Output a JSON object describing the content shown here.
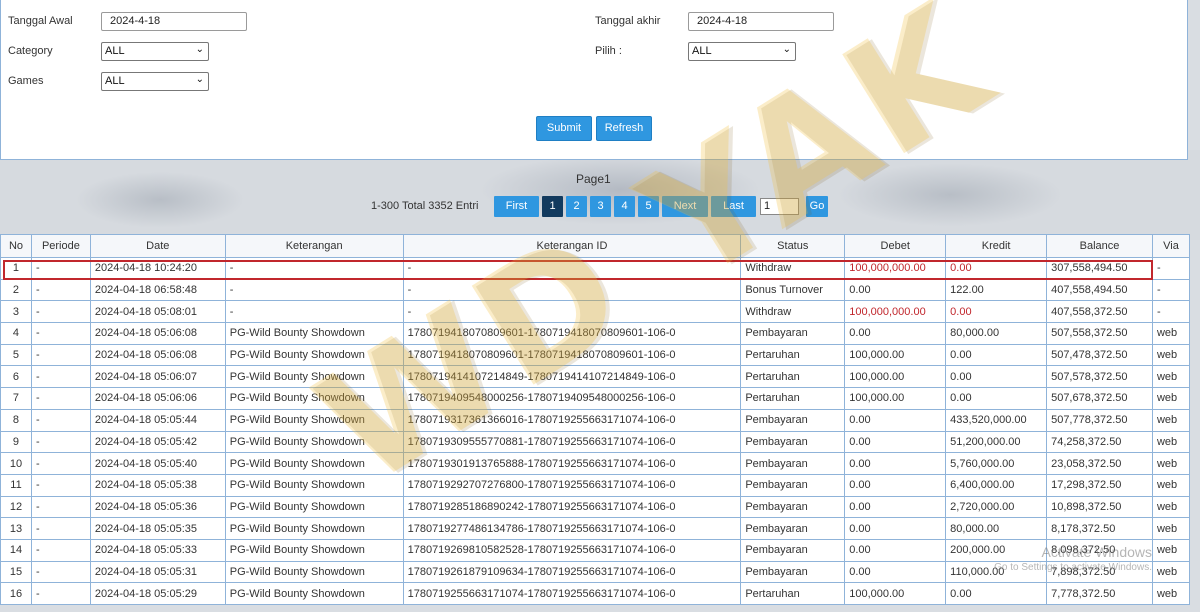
{
  "filters": {
    "tanggal_awal_label": "Tanggal Awal",
    "tanggal_awal_value": "2024-4-18",
    "tanggal_akhir_label": "Tanggal akhir",
    "tanggal_akhir_value": "2024-4-18",
    "category_label": "Category",
    "category_value": "ALL",
    "pilih_label": "Pilih :",
    "pilih_value": "ALL",
    "games_label": "Games",
    "games_value": "ALL",
    "submit_label": "Submit",
    "refresh_label": "Refresh"
  },
  "pager": {
    "title": "Page1",
    "range": "1-300 Total 3352 Entri",
    "first": "First",
    "pages": [
      "1",
      "2",
      "3",
      "4",
      "5"
    ],
    "next": "Next",
    "last": "Last",
    "page_input": "1",
    "go": "Go"
  },
  "table": {
    "headers": [
      "No",
      "Periode",
      "Date",
      "Keterangan",
      "Keterangan ID",
      "Status",
      "Debet",
      "Kredit",
      "Balance",
      "Via"
    ],
    "rows": [
      [
        "1",
        "-",
        "2024-04-18 10:24:20",
        "-",
        "-",
        "Withdraw",
        "100,000,000.00",
        "0.00",
        "307,558,494.50",
        "-"
      ],
      [
        "2",
        "-",
        "2024-04-18 06:58:48",
        "-",
        "-",
        "Bonus Turnover",
        "0.00",
        "122.00",
        "407,558,494.50",
        "-"
      ],
      [
        "3",
        "-",
        "2024-04-18 05:08:01",
        "-",
        "-",
        "Withdraw",
        "100,000,000.00",
        "0.00",
        "407,558,372.50",
        "-"
      ],
      [
        "4",
        "-",
        "2024-04-18 05:06:08",
        "PG-Wild Bounty Showdown",
        "1780719418070809601-1780719418070809601-106-0",
        "Pembayaran",
        "0.00",
        "80,000.00",
        "507,558,372.50",
        "web"
      ],
      [
        "5",
        "-",
        "2024-04-18 05:06:08",
        "PG-Wild Bounty Showdown",
        "1780719418070809601-1780719418070809601-106-0",
        "Pertaruhan",
        "100,000.00",
        "0.00",
        "507,478,372.50",
        "web"
      ],
      [
        "6",
        "-",
        "2024-04-18 05:06:07",
        "PG-Wild Bounty Showdown",
        "1780719414107214849-1780719414107214849-106-0",
        "Pertaruhan",
        "100,000.00",
        "0.00",
        "507,578,372.50",
        "web"
      ],
      [
        "7",
        "-",
        "2024-04-18 05:06:06",
        "PG-Wild Bounty Showdown",
        "1780719409548000256-1780719409548000256-106-0",
        "Pertaruhan",
        "100,000.00",
        "0.00",
        "507,678,372.50",
        "web"
      ],
      [
        "8",
        "-",
        "2024-04-18 05:05:44",
        "PG-Wild Bounty Showdown",
        "1780719317361366016-1780719255663171074-106-0",
        "Pembayaran",
        "0.00",
        "433,520,000.00",
        "507,778,372.50",
        "web"
      ],
      [
        "9",
        "-",
        "2024-04-18 05:05:42",
        "PG-Wild Bounty Showdown",
        "1780719309555770881-1780719255663171074-106-0",
        "Pembayaran",
        "0.00",
        "51,200,000.00",
        "74,258,372.50",
        "web"
      ],
      [
        "10",
        "-",
        "2024-04-18 05:05:40",
        "PG-Wild Bounty Showdown",
        "1780719301913765888-1780719255663171074-106-0",
        "Pembayaran",
        "0.00",
        "5,760,000.00",
        "23,058,372.50",
        "web"
      ],
      [
        "11",
        "-",
        "2024-04-18 05:05:38",
        "PG-Wild Bounty Showdown",
        "1780719292707276800-1780719255663171074-106-0",
        "Pembayaran",
        "0.00",
        "6,400,000.00",
        "17,298,372.50",
        "web"
      ],
      [
        "12",
        "-",
        "2024-04-18 05:05:36",
        "PG-Wild Bounty Showdown",
        "1780719285186890242-1780719255663171074-106-0",
        "Pembayaran",
        "0.00",
        "2,720,000.00",
        "10,898,372.50",
        "web"
      ],
      [
        "13",
        "-",
        "2024-04-18 05:05:35",
        "PG-Wild Bounty Showdown",
        "1780719277486134786-1780719255663171074-106-0",
        "Pembayaran",
        "0.00",
        "80,000.00",
        "8,178,372.50",
        "web"
      ],
      [
        "14",
        "-",
        "2024-04-18 05:05:33",
        "PG-Wild Bounty Showdown",
        "1780719269810582528-1780719255663171074-106-0",
        "Pembayaran",
        "0.00",
        "200,000.00",
        "8,098,372.50",
        "web"
      ],
      [
        "15",
        "-",
        "2024-04-18 05:05:31",
        "PG-Wild Bounty Showdown",
        "1780719261879109634-1780719255663171074-106-0",
        "Pembayaran",
        "0.00",
        "110,000.00",
        "7,898,372.50",
        "web"
      ],
      [
        "16",
        "-",
        "2024-04-18 05:05:29",
        "PG-Wild Bounty Showdown",
        "1780719255663171074-1780719255663171074-106-0",
        "Pertaruhan",
        "100,000.00",
        "0.00",
        "7,778,372.50",
        "web"
      ]
    ]
  },
  "colors": {
    "accent": "#2f97e0",
    "active_page": "#123a5e",
    "highlight": "#c1272d",
    "negative": "#c1272d"
  },
  "watermark_text": "WD YAK",
  "os_overlay": {
    "line1": "Activate Windows",
    "line2": "Go to Settings to activate Windows."
  }
}
